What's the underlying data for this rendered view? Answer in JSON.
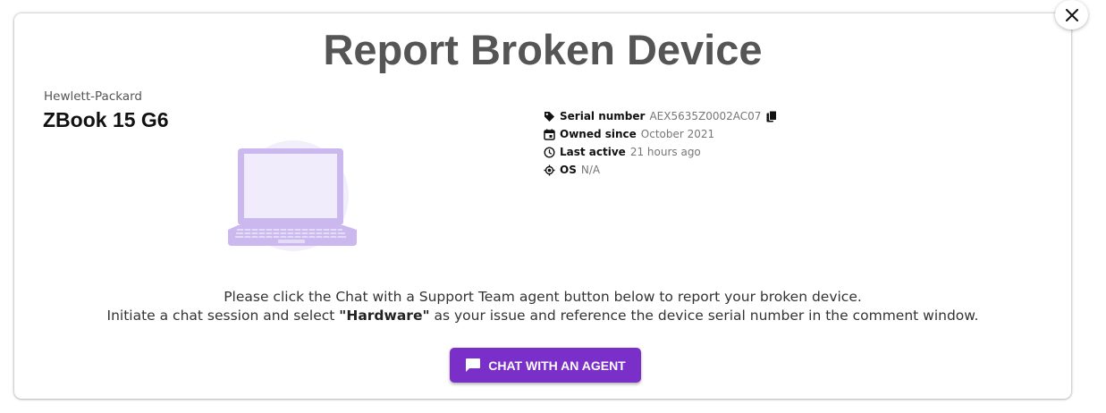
{
  "dialog": {
    "title": "Report Broken Device",
    "close_icon": "close-icon"
  },
  "device": {
    "manufacturer": "Hewlett-Packard",
    "model": "ZBook 15 G6",
    "image_icon": "laptop-icon"
  },
  "specs": [
    {
      "icon": "tag-icon",
      "label": "Serial number",
      "value": "AEX5635Z0002AC07"
    },
    {
      "icon": "calendar-icon",
      "label": "Owned since",
      "value": "October 2021"
    },
    {
      "icon": "clock-icon",
      "label": "Last active",
      "value": "21 hours ago"
    },
    {
      "icon": "os-icon",
      "label": "OS",
      "value": "N/A"
    }
  ],
  "message": {
    "line1": "Please click the Chat with a Support Team agent button below to report your broken device.",
    "line2_prefix": "Initiate a chat session and select ",
    "line2_bold": "\"Hardware\"",
    "line2_suffix": " as your issue and reference the device serial number in the comment window."
  },
  "chat_button": {
    "label": "CHAT WITH AN AGENT",
    "icon": "chat-icon"
  },
  "colors": {
    "accent": "#7b2fc9",
    "title": "#555555",
    "laptop": "#cbb8ee"
  }
}
